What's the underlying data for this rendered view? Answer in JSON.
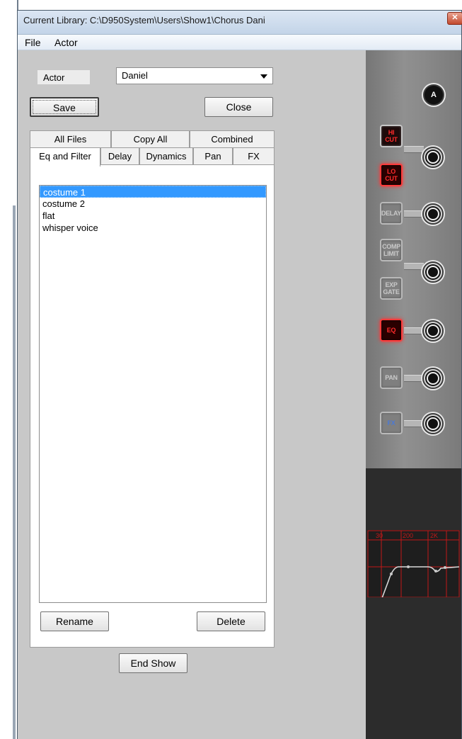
{
  "window": {
    "title": "Current Library: C:\\D950System\\Users\\Show1\\Chorus Dani",
    "close_glyph": "✕"
  },
  "menu": {
    "items": [
      {
        "label": "File"
      },
      {
        "label": "Actor"
      }
    ]
  },
  "actor": {
    "label": "Actor",
    "selected": "Daniel"
  },
  "buttons": {
    "save": "Save",
    "close": "Close",
    "rename": "Rename",
    "delete": "Delete",
    "end_show": "End Show"
  },
  "tabs": {
    "row1": [
      {
        "label": "All Files"
      },
      {
        "label": "Copy All"
      },
      {
        "label": "Combined"
      }
    ],
    "row2": [
      {
        "label": "Eq and Filter",
        "active": true
      },
      {
        "label": "Delay"
      },
      {
        "label": "Dynamics"
      },
      {
        "label": "Pan"
      },
      {
        "label": "FX"
      }
    ]
  },
  "files": [
    {
      "name": "costume 1",
      "selected": true
    },
    {
      "name": "costume 2"
    },
    {
      "name": "flat"
    },
    {
      "name": "whisper voice"
    }
  ],
  "strip": {
    "automation_knob": "A",
    "buttons": [
      {
        "label": "HI CUT",
        "state": "dark",
        "name": "hi-cut"
      },
      {
        "label": "LO CUT",
        "state": "lit",
        "name": "lo-cut"
      },
      {
        "label": "DELAY",
        "state": "off",
        "name": "delay"
      },
      {
        "label": "COMP LIMIT",
        "state": "off",
        "name": "comp-limit"
      },
      {
        "label": "EXP GATE",
        "state": "off",
        "name": "exp-gate"
      },
      {
        "label": "EQ",
        "state": "lit",
        "name": "eq"
      },
      {
        "label": "PAN",
        "state": "off",
        "name": "pan"
      },
      {
        "label": "FX",
        "state": "off-blue",
        "name": "fx"
      }
    ],
    "eq_graph": {
      "freq_labels": [
        "30",
        "200",
        "2K"
      ],
      "colors": {
        "grid": "#c21818",
        "curve": "#d8d8d8",
        "bg": "#1e1e1e"
      }
    }
  }
}
